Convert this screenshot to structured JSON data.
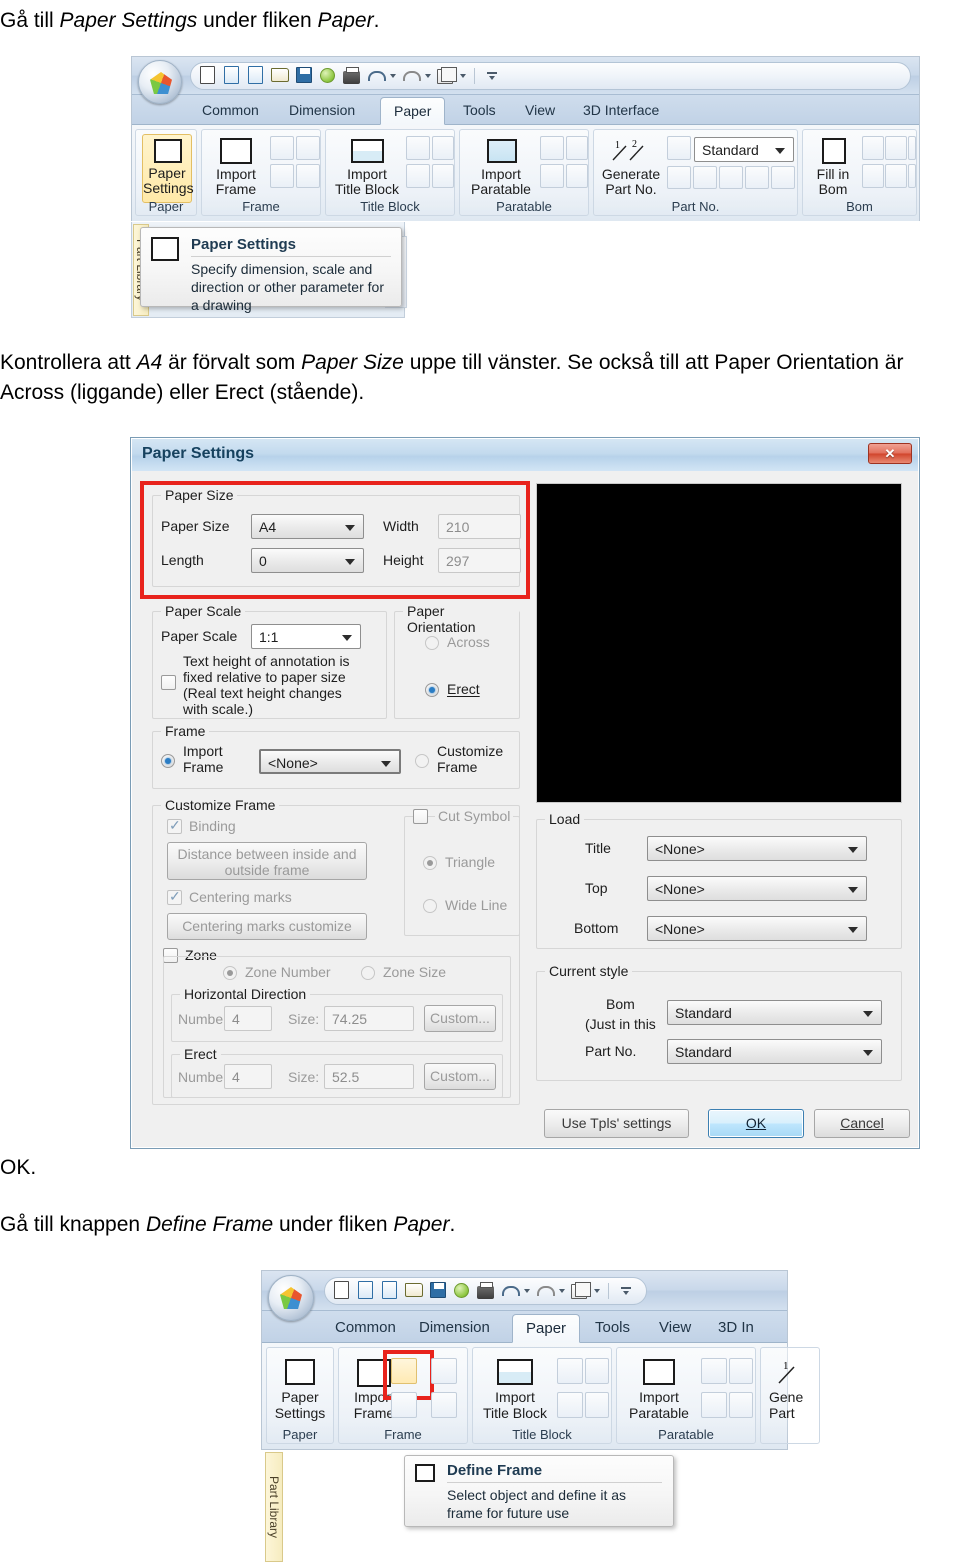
{
  "document": {
    "line1_pre": "Gå till ",
    "line1_em1": "Paper Settings",
    "line1_mid": " under fliken ",
    "line1_em2": "Paper",
    "line1_end": ".",
    "para1_a": "Kontrollera att ",
    "para1_em1": "A4",
    "para1_b": " är förvalt som ",
    "para1_em2": "Paper Size",
    "para1_c": " uppe till vänster. Se också till att Paper Orientation är Across (liggande) eller Erect (stående).",
    "ok_line": "OK.",
    "line3_pre": "Gå till knappen ",
    "line3_em1": "Define Frame",
    "line3_mid": " under fliken ",
    "line3_em2": "Paper",
    "line3_end": "."
  },
  "ribbon1": {
    "tabs": [
      {
        "label": "Common",
        "active": false
      },
      {
        "label": "Dimension",
        "active": false
      },
      {
        "label": "Paper",
        "active": true
      },
      {
        "label": "Tools",
        "active": false
      },
      {
        "label": "View",
        "active": false
      },
      {
        "label": "3D Interface",
        "active": false
      }
    ],
    "groups": [
      {
        "title": "Paper",
        "big": "Paper\nSettings"
      },
      {
        "title": "Frame",
        "big": "Import\nFrame"
      },
      {
        "title": "Title Block",
        "big": "Import\nTitle Block"
      },
      {
        "title": "Paratable",
        "big": "Import\nParatable"
      },
      {
        "title": "Part No.",
        "big": "Generate\nPart No."
      },
      {
        "title": "Bom",
        "big": "Fill in\nBom"
      }
    ],
    "paper_settings_label_1": "Paper",
    "paper_settings_label_2": "Settings",
    "import_frame_1": "Import",
    "import_frame_2": "Frame",
    "import_title_1": "Import",
    "import_title_2": "Title Block",
    "import_para_1": "Import",
    "import_para_2": "Paratable",
    "generate_1": "Generate",
    "generate_2": "Part No.",
    "fillin_1": "Fill in",
    "fillin_2": "Bom",
    "style_combo": "Standard",
    "sidetab": "Part Library"
  },
  "tooltip1": {
    "title": "Paper Settings",
    "body": "Specify dimension, scale and direction or other parameter for a drawing"
  },
  "dialog": {
    "title": "Paper Settings",
    "close_label": "✕",
    "paper_size": {
      "caption": "Paper Size",
      "label_size": "Paper Size",
      "value_size": "A4",
      "label_length": "Length",
      "value_length": "0",
      "label_width": "Width",
      "value_width": "210",
      "label_height": "Height",
      "value_height": "297"
    },
    "paper_scale": {
      "caption": "Paper Scale",
      "label_scale": "Paper Scale",
      "value_scale": "1:1",
      "checkbox_text_l1": "Text height of annotation is",
      "checkbox_text_l2": "fixed relative to paper size",
      "checkbox_text_l3": "(Real text height changes",
      "checkbox_text_l4": "with scale.)",
      "checkbox_checked": false
    },
    "paper_orientation": {
      "caption": "Paper Orientation",
      "option_across": "Across",
      "option_erect": "Erect",
      "selected": "Erect"
    },
    "frame": {
      "caption": "Frame",
      "import_l1": "Import",
      "import_l2": "Frame",
      "combo_value": "<None>",
      "customize_l1": "Customize",
      "customize_l2": "Frame",
      "selected": "Import Frame"
    },
    "customize_frame": {
      "caption": "Customize Frame",
      "binding": "Binding",
      "binding_checked": true,
      "distance_btn_l1": "Distance between inside and",
      "distance_btn_l2": "outside frame",
      "centering_marks": "Centering marks",
      "centering_checked": true,
      "centering_btn": "Centering marks customize",
      "zone": "Zone",
      "zone_checked": false,
      "zone_number": "Zone Number",
      "zone_size": "Zone Size",
      "zone_selected": "Zone Number",
      "horizontal": {
        "caption": "Horizontal Direction",
        "label_number": "Numbe",
        "value_number": "4",
        "label_size": "Size:",
        "value_size": "74.25",
        "custom_btn": "Custom..."
      },
      "erect": {
        "caption": "Erect",
        "label_number": "Numbe",
        "value_number": "4",
        "label_size": "Size:",
        "value_size": "52.5",
        "custom_btn": "Custom..."
      }
    },
    "cut_symbol": {
      "caption": "Cut Symbol",
      "checked": false,
      "option_triangle": "Triangle",
      "option_wide_line": "Wide Line",
      "selected": "Triangle"
    },
    "load": {
      "caption": "Load",
      "label_title": "Title",
      "value_title": "<None>",
      "label_top": "Top",
      "value_top": "<None>",
      "label_bottom": "Bottom",
      "value_bottom": "<None>"
    },
    "current_style": {
      "caption": "Current style",
      "label_bom_l1": "Bom",
      "label_bom_l2": "(Just in this",
      "value_bom": "Standard",
      "label_part": "Part No.",
      "value_part": "Standard"
    },
    "buttons": {
      "use_tpls": "Use Tpls' settings",
      "ok": "OK",
      "cancel": "Cancel"
    }
  },
  "ribbon2": {
    "tabs": [
      {
        "label": "Common",
        "active": false
      },
      {
        "label": "Dimension",
        "active": false
      },
      {
        "label": "Paper",
        "active": true
      },
      {
        "label": "Tools",
        "active": false
      },
      {
        "label": "View",
        "active": false
      },
      {
        "label": "3D In",
        "active": false
      }
    ],
    "paper_settings_label_1": "Paper",
    "paper_settings_label_2": "Settings",
    "import_frame_1": "Import",
    "import_frame_2": "Frame",
    "import_title_1": "Import",
    "import_title_2": "Title Block",
    "import_para_1": "Import",
    "import_para_2": "Paratable",
    "generate_1": "Gene",
    "generate_2": "Part",
    "groups": [
      {
        "title": "Paper"
      },
      {
        "title": "Frame"
      },
      {
        "title": "Title Block"
      },
      {
        "title": "Paratable"
      }
    ],
    "sidetab": "Part Library"
  },
  "tooltip2": {
    "title": "Define Frame",
    "body": "Select object and define it as frame for future use"
  },
  "colors": {
    "highlight_red": "#e8231c",
    "selected_yellow": "#ffe9a8",
    "accent_blue": "#2b7dc4",
    "preview_black": "#000000"
  }
}
